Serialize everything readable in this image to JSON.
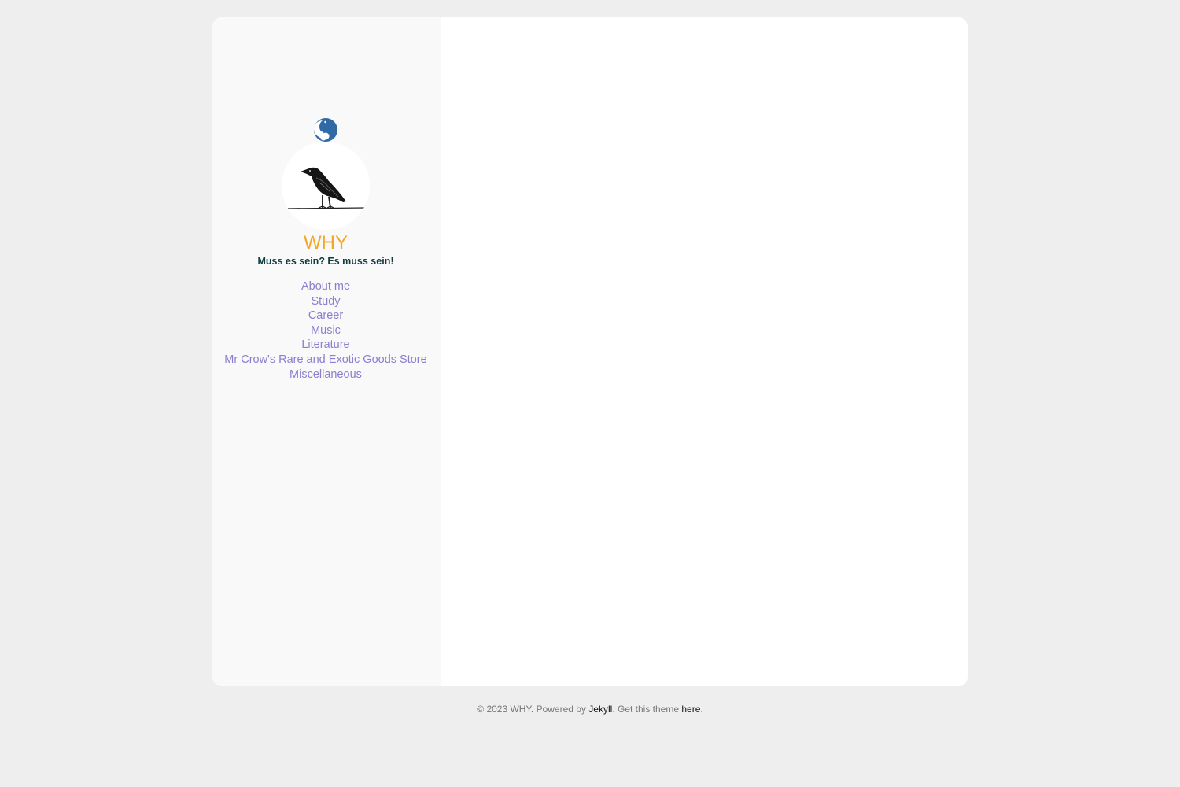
{
  "sidebar": {
    "site_title": "WHY",
    "tagline": "Muss es sein? Es muss sein!",
    "theme_toggle_icon": "moon-icon",
    "avatar_icon": "crow-avatar",
    "nav": [
      {
        "label": "About me"
      },
      {
        "label": "Study"
      },
      {
        "label": "Career"
      },
      {
        "label": "Music"
      },
      {
        "label": "Literature"
      },
      {
        "label": "Mr Crow's Rare and Exotic Goods Store"
      },
      {
        "label": "Miscellaneous"
      }
    ]
  },
  "footer": {
    "copyright": "© 2023 WHY. Powered by ",
    "jekyll_link": "Jekyll",
    "middle": ". Get this theme ",
    "theme_link": "here",
    "end": "."
  },
  "colors": {
    "page_bg": "#eeeeee",
    "sidebar_bg": "#f9f9f9",
    "title": "#f5a623",
    "tagline": "#0d3b3e",
    "nav_link": "#8a7fcf",
    "toggle": "#2f6aa6"
  }
}
